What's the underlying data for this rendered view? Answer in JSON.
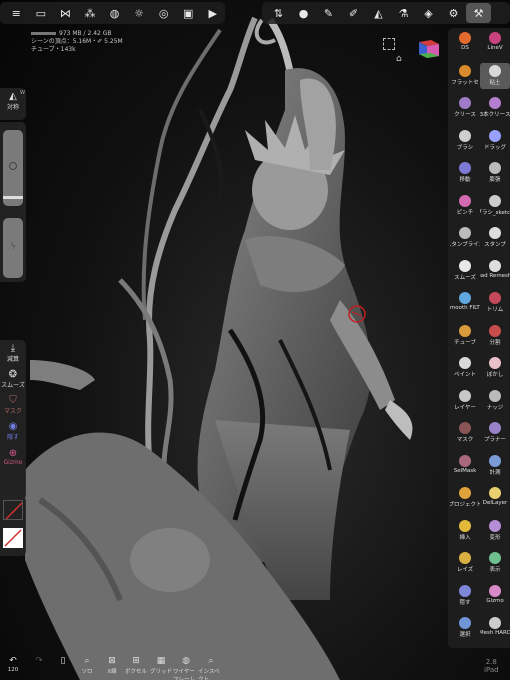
{
  "stats": {
    "memory": "973 MB / 2.42 GB",
    "scene_vertices": "シーンの頂点：5.16M・✐ 5.25M",
    "selected": "チューブ・143k"
  },
  "left_panel": {
    "symmetry_label": "対称",
    "symmetry_badge": "W",
    "subtract_label": "減算",
    "smooth_label": "スムーズ",
    "mask_label": "マスク",
    "hide_label": "隠す",
    "gizmo_label": "Gizmo"
  },
  "right_tools": [
    {
      "label": "DS",
      "color": "#e26a2c"
    },
    {
      "label": "LineV",
      "color": "#c9447f"
    },
    {
      "label": "フラットセ",
      "color": "#d98b2d"
    },
    {
      "label": "粘土",
      "color": "#d8d8d8"
    },
    {
      "label": "クリース",
      "color": "#a07cc8"
    },
    {
      "label": "3本クリース",
      "color": "#b57fd0"
    },
    {
      "label": "ブラシ",
      "color": "#cfcfcf"
    },
    {
      "label": "ドラッグ",
      "color": "#9aa0ff"
    },
    {
      "label": "移動",
      "color": "#7d7bd6"
    },
    {
      "label": "膨張",
      "color": "#bbbbbb"
    },
    {
      "label": "ピンチ",
      "color": "#d36bb0"
    },
    {
      "label": "ブラシ_sketch",
      "color": "#cccccc"
    },
    {
      "label": "スタンプライン",
      "color": "#bbbbbb"
    },
    {
      "label": "スタンプ",
      "color": "#dddddd"
    },
    {
      "label": "スムーズ",
      "color": "#e8e8e8"
    },
    {
      "label": "Quad Remesher",
      "color": "#dddddd"
    },
    {
      "label": "Smooth FILTR",
      "color": "#5fa8e0"
    },
    {
      "label": "トリム",
      "color": "#c44a5a"
    },
    {
      "label": "チューブ",
      "color": "#d89a3b"
    },
    {
      "label": "分割",
      "color": "#c74d4d"
    },
    {
      "label": "ペイント",
      "color": "#d8d8d8"
    },
    {
      "label": "ぼかし",
      "color": "#e8c0c8"
    },
    {
      "label": "レイヤー",
      "color": "#c8c8c8"
    },
    {
      "label": "ナッジ",
      "color": "#bbbbbb"
    },
    {
      "label": "マスク",
      "color": "#8a5555"
    },
    {
      "label": "プラナー",
      "color": "#9a82c9"
    },
    {
      "label": "SelMask",
      "color": "#a9697c"
    },
    {
      "label": "計測",
      "color": "#7b9bd6"
    },
    {
      "label": "プロジェクト",
      "color": "#e0a33b"
    },
    {
      "label": "DelLayer",
      "color": "#e8d070"
    },
    {
      "label": "挿入",
      "color": "#e2b93b"
    },
    {
      "label": "変形",
      "color": "#b68ed8"
    },
    {
      "label": "レイズ",
      "color": "#d8b040"
    },
    {
      "label": "表示",
      "color": "#6fbf8f"
    },
    {
      "label": "隠す",
      "color": "#7d86d9"
    },
    {
      "label": "Gizmo",
      "color": "#d88ac6"
    },
    {
      "label": "選択",
      "color": "#6f95d8"
    },
    {
      "label": "Mesh HARD",
      "color": "#cccccc"
    }
  ],
  "bottom_bar": {
    "undo_count": "120",
    "solo_label": "ソロ",
    "xray_label": "X線",
    "voxel_label": "ボクセル",
    "grid_label": "グリッド",
    "wireframe_label": "ワイヤーフレーム",
    "inspect_label": "インスペクト",
    "version": "2.8",
    "device": "iPad"
  }
}
